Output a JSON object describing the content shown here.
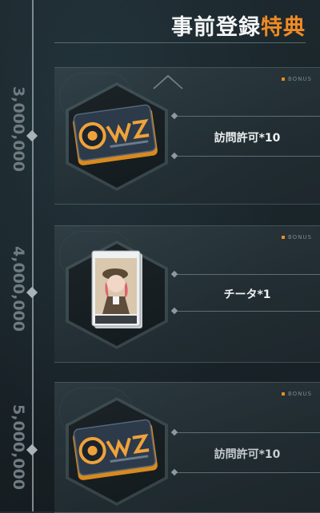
{
  "header": {
    "title_main": "事前登録",
    "title_accent": "特典"
  },
  "milestones": [
    {
      "label": "3,000,000"
    },
    {
      "label": "4,000,000"
    },
    {
      "label": "5,000,000"
    }
  ],
  "rewards": [
    {
      "label": "訪問許可*10",
      "bonus": "BONUS",
      "icon": "visit-permit-icon"
    },
    {
      "label": "チータ*1",
      "bonus": "BONUS",
      "icon": "cheetah-card-icon"
    },
    {
      "label": "訪問許可*10",
      "bonus": "BONUS",
      "icon": "visit-permit-icon"
    }
  ],
  "colors": {
    "accent": "#f08a24",
    "background": "#1c282d"
  },
  "collapse_icon": "chevron-up-icon"
}
